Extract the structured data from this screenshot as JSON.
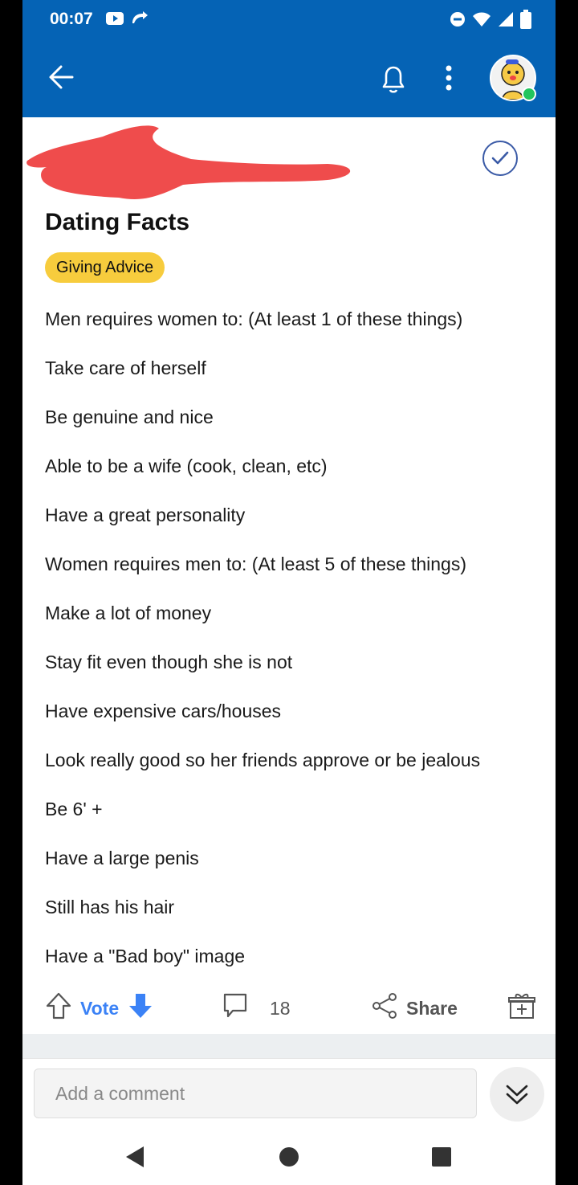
{
  "status_bar": {
    "time": "00:07",
    "left_icons": [
      "youtube-icon",
      "call-forward-icon"
    ],
    "right_icons": [
      "dnd-icon",
      "wifi-icon",
      "signal-icon",
      "battery-icon"
    ]
  },
  "app_bar": {
    "icons": [
      "back-arrow-icon",
      "bell-icon",
      "more-vert-icon",
      "avatar"
    ]
  },
  "post": {
    "title": "Dating Facts",
    "tag": "Giving Advice",
    "lines": [
      "Men requires women to: (At least 1 of these things)",
      "Take care of herself",
      "Be genuine and nice",
      "Able to be a wife (cook, clean, etc)",
      "Have a great personality",
      "Women requires men to:  (At least 5 of these things)",
      "Make a lot of money",
      "Stay fit even though she is not",
      "Have expensive cars/houses",
      "Look really good so her friends approve or be jealous",
      "Be 6' +",
      "Have a large penis",
      "Still has his hair",
      "Have a \"Bad boy\" image"
    ]
  },
  "actions": {
    "vote_label": "Vote",
    "comment_count": "18",
    "share_label": "Share"
  },
  "comment": {
    "placeholder": "Add a comment"
  },
  "colors": {
    "brand": "#0563b5",
    "tag": "#f7cc3d",
    "vote": "#3b82f6",
    "redaction": "#ef4c4c"
  }
}
